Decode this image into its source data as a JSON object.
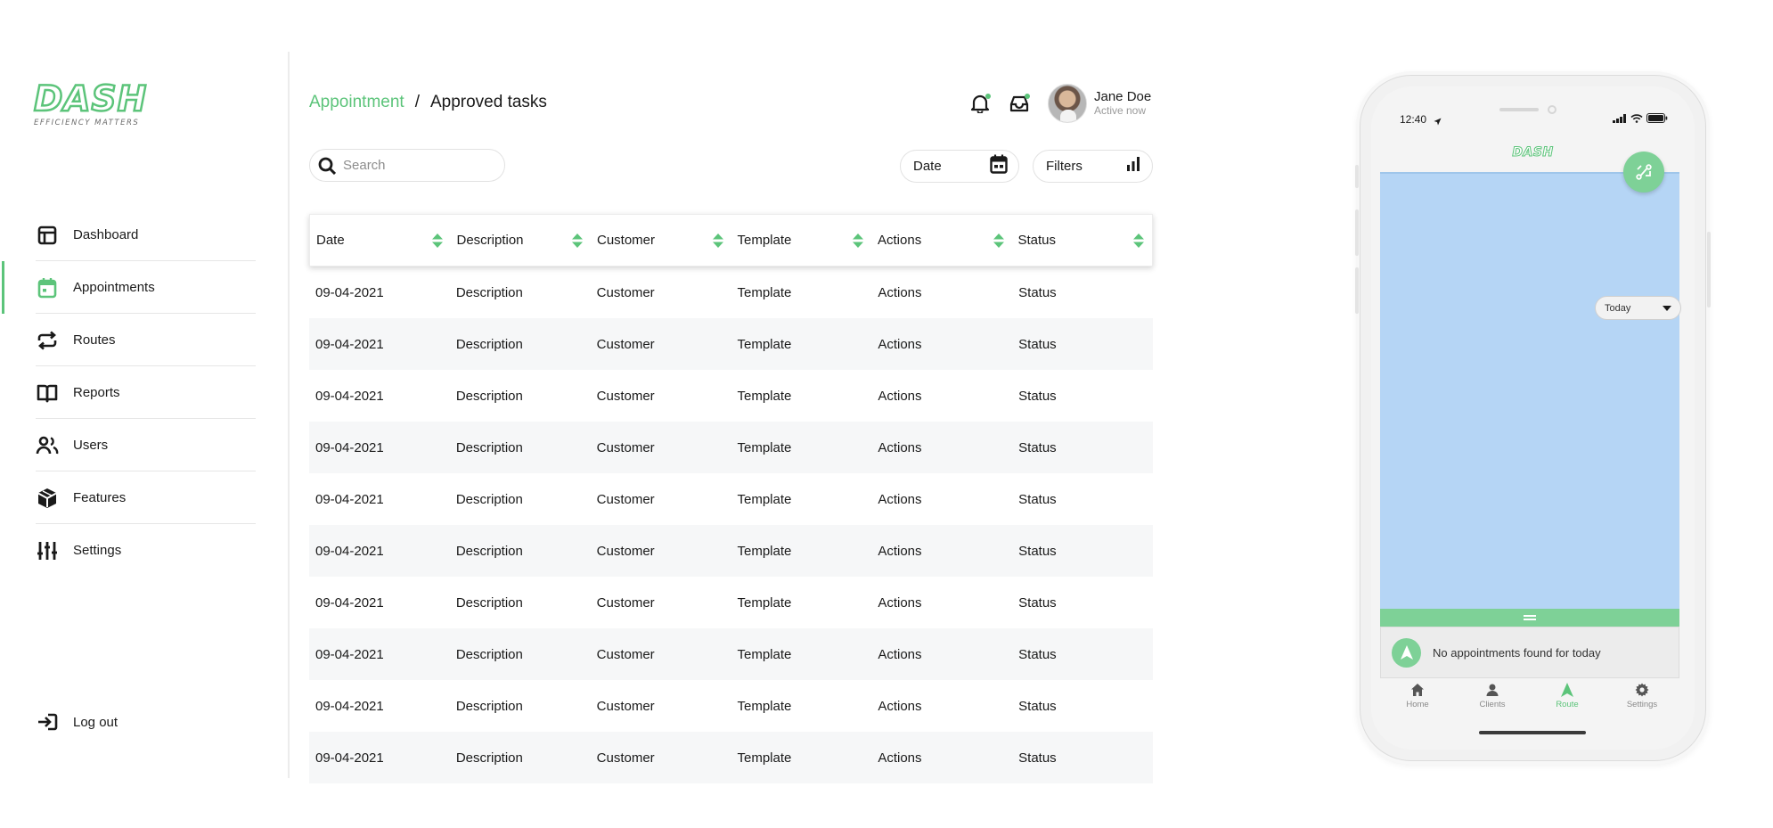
{
  "brand": {
    "logo_text": "DASH",
    "tagline": "EFFICIENCY MATTERS",
    "accent_color": "#5cc47a"
  },
  "sidebar": {
    "items": [
      {
        "label": "Dashboard",
        "icon": "dashboard-icon",
        "active": false
      },
      {
        "label": "Appointments",
        "icon": "calendar-icon",
        "active": true
      },
      {
        "label": "Routes",
        "icon": "routes-icon",
        "active": false
      },
      {
        "label": "Reports",
        "icon": "book-icon",
        "active": false
      },
      {
        "label": "Users",
        "icon": "users-icon",
        "active": false
      },
      {
        "label": "Features",
        "icon": "cube-icon",
        "active": false
      },
      {
        "label": "Settings",
        "icon": "sliders-icon",
        "active": false
      }
    ],
    "logout_label": "Log out"
  },
  "header": {
    "breadcrumb_parent": "Appointment",
    "breadcrumb_separator": "/",
    "breadcrumb_current": "Approved tasks",
    "user_name": "Jane Doe",
    "user_status": "Active now"
  },
  "toolbar": {
    "search_placeholder": "Search",
    "search_value": "",
    "date_label": "Date",
    "filters_label": "Filters"
  },
  "table": {
    "columns": [
      "Date",
      "Description",
      "Customer",
      "Template",
      "Actions",
      "Status"
    ],
    "rows": [
      [
        "09-04-2021",
        "Description",
        "Customer",
        "Template",
        "Actions",
        "Status"
      ],
      [
        "09-04-2021",
        "Description",
        "Customer",
        "Template",
        "Actions",
        "Status"
      ],
      [
        "09-04-2021",
        "Description",
        "Customer",
        "Template",
        "Actions",
        "Status"
      ],
      [
        "09-04-2021",
        "Description",
        "Customer",
        "Template",
        "Actions",
        "Status"
      ],
      [
        "09-04-2021",
        "Description",
        "Customer",
        "Template",
        "Actions",
        "Status"
      ],
      [
        "09-04-2021",
        "Description",
        "Customer",
        "Template",
        "Actions",
        "Status"
      ],
      [
        "09-04-2021",
        "Description",
        "Customer",
        "Template",
        "Actions",
        "Status"
      ],
      [
        "09-04-2021",
        "Description",
        "Customer",
        "Template",
        "Actions",
        "Status"
      ],
      [
        "09-04-2021",
        "Description",
        "Customer",
        "Template",
        "Actions",
        "Status"
      ],
      [
        "09-04-2021",
        "Description",
        "Customer",
        "Template",
        "Actions",
        "Status"
      ]
    ]
  },
  "phone": {
    "time": "12:40",
    "app_logo": "DASH",
    "day_filter": "Today",
    "empty_message": "No appointments found for today",
    "map_color": "#b5d5f5",
    "tabs": [
      {
        "label": "Home",
        "icon": "home-icon",
        "active": false
      },
      {
        "label": "Clients",
        "icon": "person-icon",
        "active": false
      },
      {
        "label": "Route",
        "icon": "navigation-icon",
        "active": true
      },
      {
        "label": "Settings",
        "icon": "gear-icon",
        "active": false
      }
    ]
  }
}
